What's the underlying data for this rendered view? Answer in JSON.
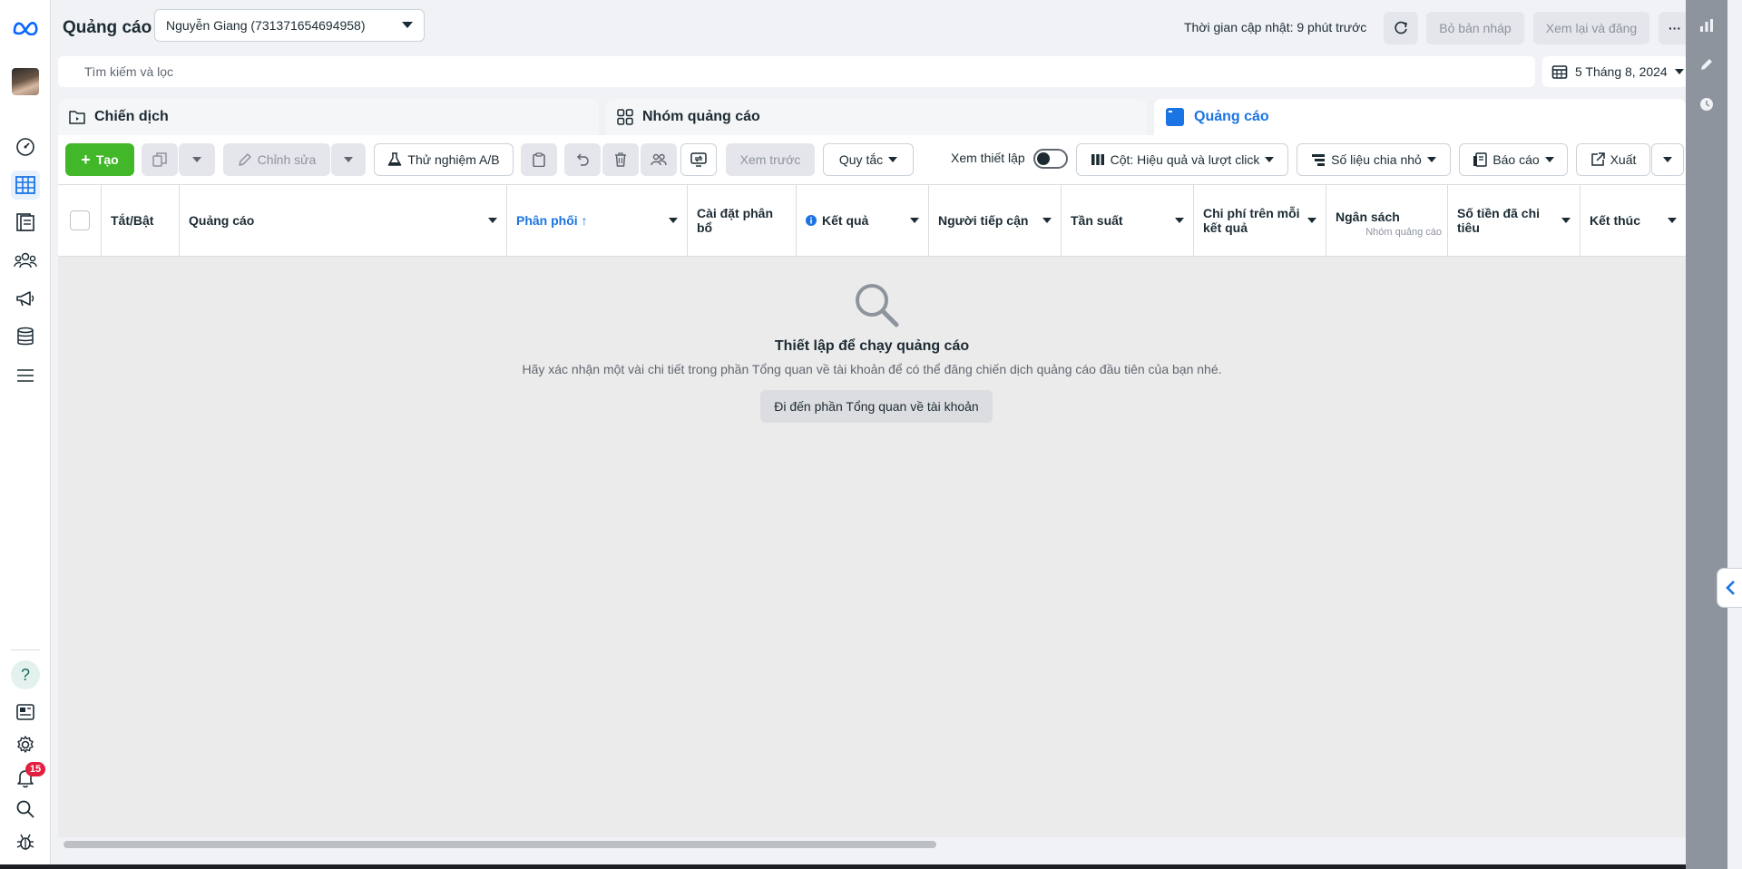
{
  "header": {
    "title": "Quảng cáo",
    "account": "Nguyễn Giang (731371654694958)",
    "update_time": "Thời gian cập nhật: 9 phút trước",
    "discard_draft": "Bỏ bản nháp",
    "review_publish": "Xem lại và đăng",
    "more_label": "···"
  },
  "search": {
    "placeholder": "Tìm kiếm và lọc",
    "date": "5 Tháng 8, 2024"
  },
  "level_tabs": {
    "campaigns": "Chiến dịch",
    "adsets": "Nhóm quảng cáo",
    "ads": "Quảng cáo"
  },
  "toolbar": {
    "create": "Tạo",
    "edit": "Chỉnh sửa",
    "ab_test": "Thử nghiệm A/B",
    "preview": "Xem trước",
    "rules": "Quy tắc",
    "view_setup": "Xem thiết lập",
    "columns": "Cột: Hiệu quả và lượt click",
    "breakdown": "Số liệu chia nhỏ",
    "reports": "Báo cáo",
    "export": "Xuất"
  },
  "table": {
    "columns": [
      {
        "label": "Tắt/Bật"
      },
      {
        "label": "Quảng cáo"
      },
      {
        "label": "Phân phối ↑"
      },
      {
        "label": "Cài đặt phân bổ"
      },
      {
        "label": "Kết quả"
      },
      {
        "label": "Người tiếp cận"
      },
      {
        "label": "Tần suất"
      },
      {
        "label": "Chi phí trên mỗi kết quả"
      },
      {
        "label": "Ngân sách",
        "sub": "Nhóm quảng cáo"
      },
      {
        "label": "Số tiền đã chi tiêu"
      },
      {
        "label": "Kết thúc"
      }
    ]
  },
  "empty_state": {
    "title": "Thiết lập để chạy quảng cáo",
    "description": "Hãy xác nhận một vài chi tiết trong phần Tổng quan về tài khoản để có thể đăng chiến dịch quảng cáo đầu tiên của bạn nhé.",
    "button": "Đi đến phần Tổng quan về tài khoản"
  },
  "nav": {
    "notification_count": "15"
  },
  "colors": {
    "accent": "#1b74e4",
    "create_green": "#42b72a",
    "badge_red": "#e41e3f"
  }
}
